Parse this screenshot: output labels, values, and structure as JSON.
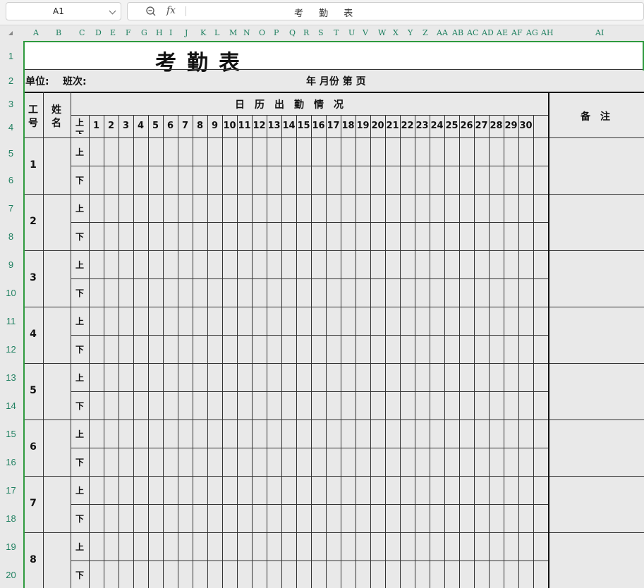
{
  "formula_bar": {
    "cell_ref": "A1",
    "fx_label": "fx",
    "value": "考 勤 表"
  },
  "columns": [
    "A",
    "B",
    "C",
    "D",
    "E",
    "F",
    "G",
    "H",
    "I",
    "J",
    "K",
    "L",
    "M",
    "N",
    "O",
    "P",
    "Q",
    "R",
    "S",
    "T",
    "U",
    "V",
    "W",
    "X",
    "Y",
    "Z",
    "AA",
    "AB",
    "AC",
    "AD",
    "AE",
    "AF",
    "AG",
    "AH",
    "AI"
  ],
  "rows": [
    "1",
    "2",
    "3",
    "4",
    "5",
    "6",
    "7",
    "8",
    "9",
    "10",
    "11",
    "12",
    "13",
    "14",
    "15",
    "16",
    "17",
    "18",
    "19",
    "20"
  ],
  "sheet": {
    "title": "考勤表",
    "unit_label": "单位:",
    "shift_label": "班次:",
    "period_label": "年 月份 第 页",
    "calendar_header": "日　历　出　勤　情　况",
    "id_header": [
      "工",
      "号"
    ],
    "name_header": [
      "姓",
      "名"
    ],
    "ampm_header": [
      "上",
      "下"
    ],
    "remarks_header": "备　注",
    "days": [
      "1",
      "2",
      "3",
      "4",
      "5",
      "6",
      "7",
      "8",
      "9",
      "10",
      "11",
      "12",
      "13",
      "14",
      "15",
      "16",
      "17",
      "18",
      "19",
      "20",
      "21",
      "22",
      "23",
      "24",
      "25",
      "26",
      "27",
      "28",
      "29",
      "30"
    ],
    "employees": [
      "1",
      "2",
      "3",
      "4",
      "5",
      "6",
      "7",
      "8"
    ],
    "am": "上",
    "pm": "下"
  },
  "colors": {
    "header_text": "#1f8060",
    "selection": "#2e9a3e",
    "grid": "#333333"
  }
}
